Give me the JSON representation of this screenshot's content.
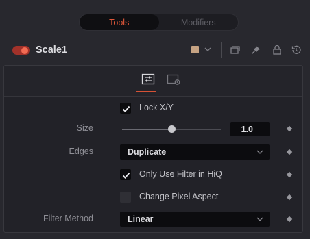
{
  "tabs": {
    "tools_label": "Tools",
    "modifiers_label": "Modifiers"
  },
  "node": {
    "name": "Scale1",
    "enabled": true,
    "color_swatch": "#c6a383"
  },
  "header_icons": [
    "color-swatch-dropdown",
    "versions-icon",
    "pin-icon",
    "lock-icon",
    "reset-icon"
  ],
  "panel_tabs": [
    "controls-tab",
    "settings-tab"
  ],
  "controls": {
    "lock_xy": {
      "label": "Lock X/Y",
      "checked": true
    },
    "size": {
      "label": "Size",
      "value": "1.0",
      "slider_fraction": 0.5
    },
    "edges": {
      "label": "Edges",
      "value": "Duplicate"
    },
    "only_use_filter": {
      "label": "Only Use Filter in HiQ",
      "checked": true
    },
    "change_pixel_aspect": {
      "label": "Change Pixel Aspect",
      "checked": false
    },
    "filter_method": {
      "label": "Filter Method",
      "value": "Linear"
    }
  },
  "colors": {
    "accent": "#e1583a",
    "background": "#28282e",
    "field": "#0c0c0f"
  }
}
